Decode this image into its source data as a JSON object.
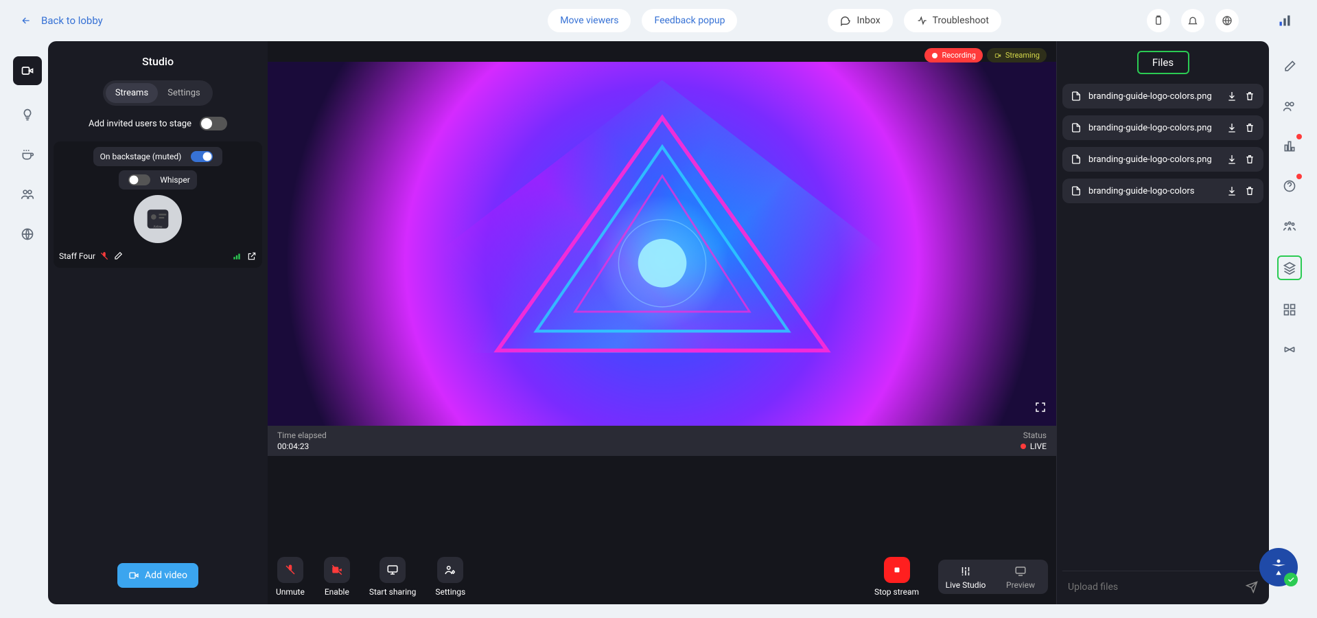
{
  "top": {
    "back": "Back to lobby",
    "move_viewers": "Move viewers",
    "feedback_popup": "Feedback popup",
    "inbox": "Inbox",
    "troubleshoot": "Troubleshoot"
  },
  "studio": {
    "title": "Studio",
    "tab_streams": "Streams",
    "tab_settings": "Settings",
    "add_invited_toggle": "Add invited users to stage",
    "backstage_label": "On backstage (muted)",
    "whisper_label": "Whisper",
    "participant_name": "Staff Four",
    "add_video": "Add video"
  },
  "stage": {
    "recording": "Recording",
    "streaming": "Streaming",
    "time_elapsed_label": "Time elapsed",
    "time_elapsed_value": "00:04:23",
    "status_label": "Status",
    "status_value": "LIVE",
    "fullscreen": "fullscreen"
  },
  "controls": {
    "unmute": "Unmute",
    "enable": "Enable",
    "start_sharing": "Start sharing",
    "settings": "Settings",
    "stop_stream": "Stop stream",
    "live_studio": "Live Studio",
    "preview": "Preview"
  },
  "files": {
    "title": "Files",
    "items": [
      {
        "name": "branding-guide-logo-colors.png"
      },
      {
        "name": "branding-guide-logo-colors.png"
      },
      {
        "name": "branding-guide-logo-colors.png"
      },
      {
        "name": "branding-guide-logo-colors"
      }
    ],
    "upload_placeholder": "Upload files"
  }
}
